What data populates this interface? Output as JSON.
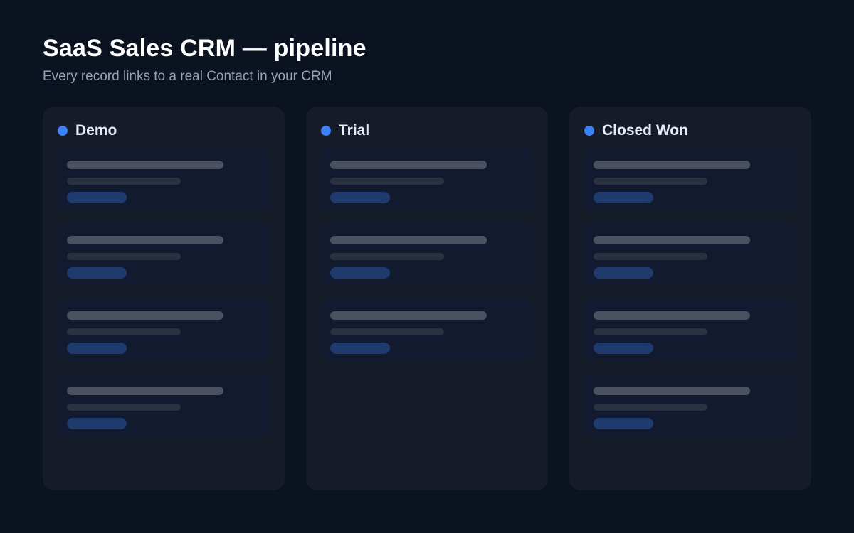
{
  "header": {
    "title": "SaaS Sales CRM — pipeline",
    "subtitle": "Every record links to a real Contact in your CRM"
  },
  "colors": {
    "background": "#0b1220",
    "column": "#151b27",
    "card": "#111a2e",
    "accent": "#3b82f6",
    "tag": "#1f3b6d"
  },
  "columns": [
    {
      "title": "Demo",
      "card_count": 4
    },
    {
      "title": "Trial",
      "card_count": 3
    },
    {
      "title": "Closed Won",
      "card_count": 4
    }
  ]
}
